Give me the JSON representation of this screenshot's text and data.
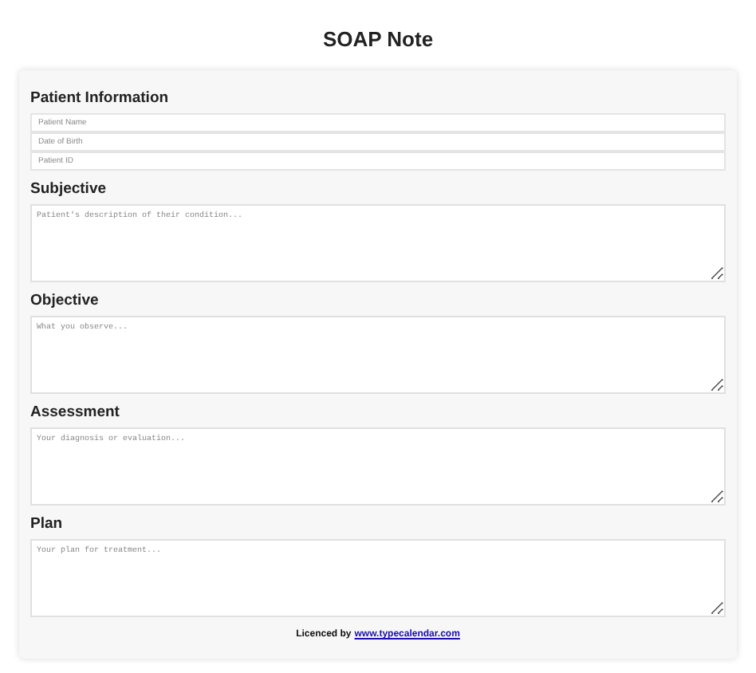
{
  "title": "SOAP Note",
  "patient_information": {
    "heading": "Patient Information",
    "fields": [
      {
        "placeholder": "Patient Name"
      },
      {
        "placeholder": "Date of Birth"
      },
      {
        "placeholder": "Patient ID"
      }
    ]
  },
  "sections": [
    {
      "heading": "Subjective",
      "placeholder": "Patient's description of their condition..."
    },
    {
      "heading": "Objective",
      "placeholder": "What you observe..."
    },
    {
      "heading": "Assessment",
      "placeholder": "Your diagnosis or evaluation..."
    },
    {
      "heading": "Plan",
      "placeholder": "Your plan for treatment..."
    }
  ],
  "footer": {
    "text": "Licenced by",
    "link": "www.typecalendar.com"
  }
}
